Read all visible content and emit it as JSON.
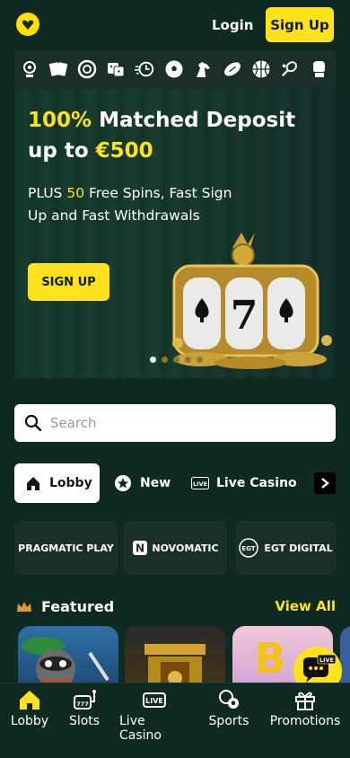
{
  "header": {
    "login_label": "Login",
    "signup_label": "Sign Up",
    "accent_color": "#ffe21b"
  },
  "categories": [
    {
      "icon": "roulette-icon"
    },
    {
      "icon": "cards-icon"
    },
    {
      "icon": "poker-chip-icon"
    },
    {
      "icon": "dice-icon"
    },
    {
      "icon": "timer-icon"
    },
    {
      "icon": "soccer-ball-icon"
    },
    {
      "icon": "horse-icon"
    },
    {
      "icon": "football-icon"
    },
    {
      "icon": "basketball-icon"
    },
    {
      "icon": "tennis-icon"
    },
    {
      "icon": "boxing-glove-icon"
    }
  ],
  "banner": {
    "headline_pre": "100%",
    "headline_mid": " Matched Deposit up to ",
    "headline_amount": "€500",
    "sub_pre": "PLUS ",
    "sub_num": "50",
    "sub_post": " Free Spins, Fast Sign Up and Fast Withdrawals",
    "cta_label": "SIGN UP",
    "slides": 5,
    "active_slide": 0
  },
  "search": {
    "placeholder": "Search"
  },
  "tabs": [
    {
      "label": "Lobby",
      "icon": "home-icon",
      "active": true
    },
    {
      "label": "New",
      "icon": "star-icon"
    },
    {
      "label": "Live Casino",
      "icon": "live-icon"
    }
  ],
  "providers": [
    {
      "name": "PRAGMATIC PLAY"
    },
    {
      "name": "NOVOMATIC"
    },
    {
      "name": "EGT DIGITAL"
    }
  ],
  "featured": {
    "title": "Featured",
    "view_all": "View All"
  },
  "chat": {
    "badge": "LIVE"
  },
  "bottom_nav": [
    {
      "label": "Lobby",
      "icon": "home-icon",
      "active": true
    },
    {
      "label": "Slots",
      "icon": "slot-machine-icon"
    },
    {
      "label": "Live Casino",
      "icon": "live-icon"
    },
    {
      "label": "Sports",
      "icon": "sports-balls-icon"
    },
    {
      "label": "Promotions",
      "icon": "gift-icon"
    }
  ]
}
